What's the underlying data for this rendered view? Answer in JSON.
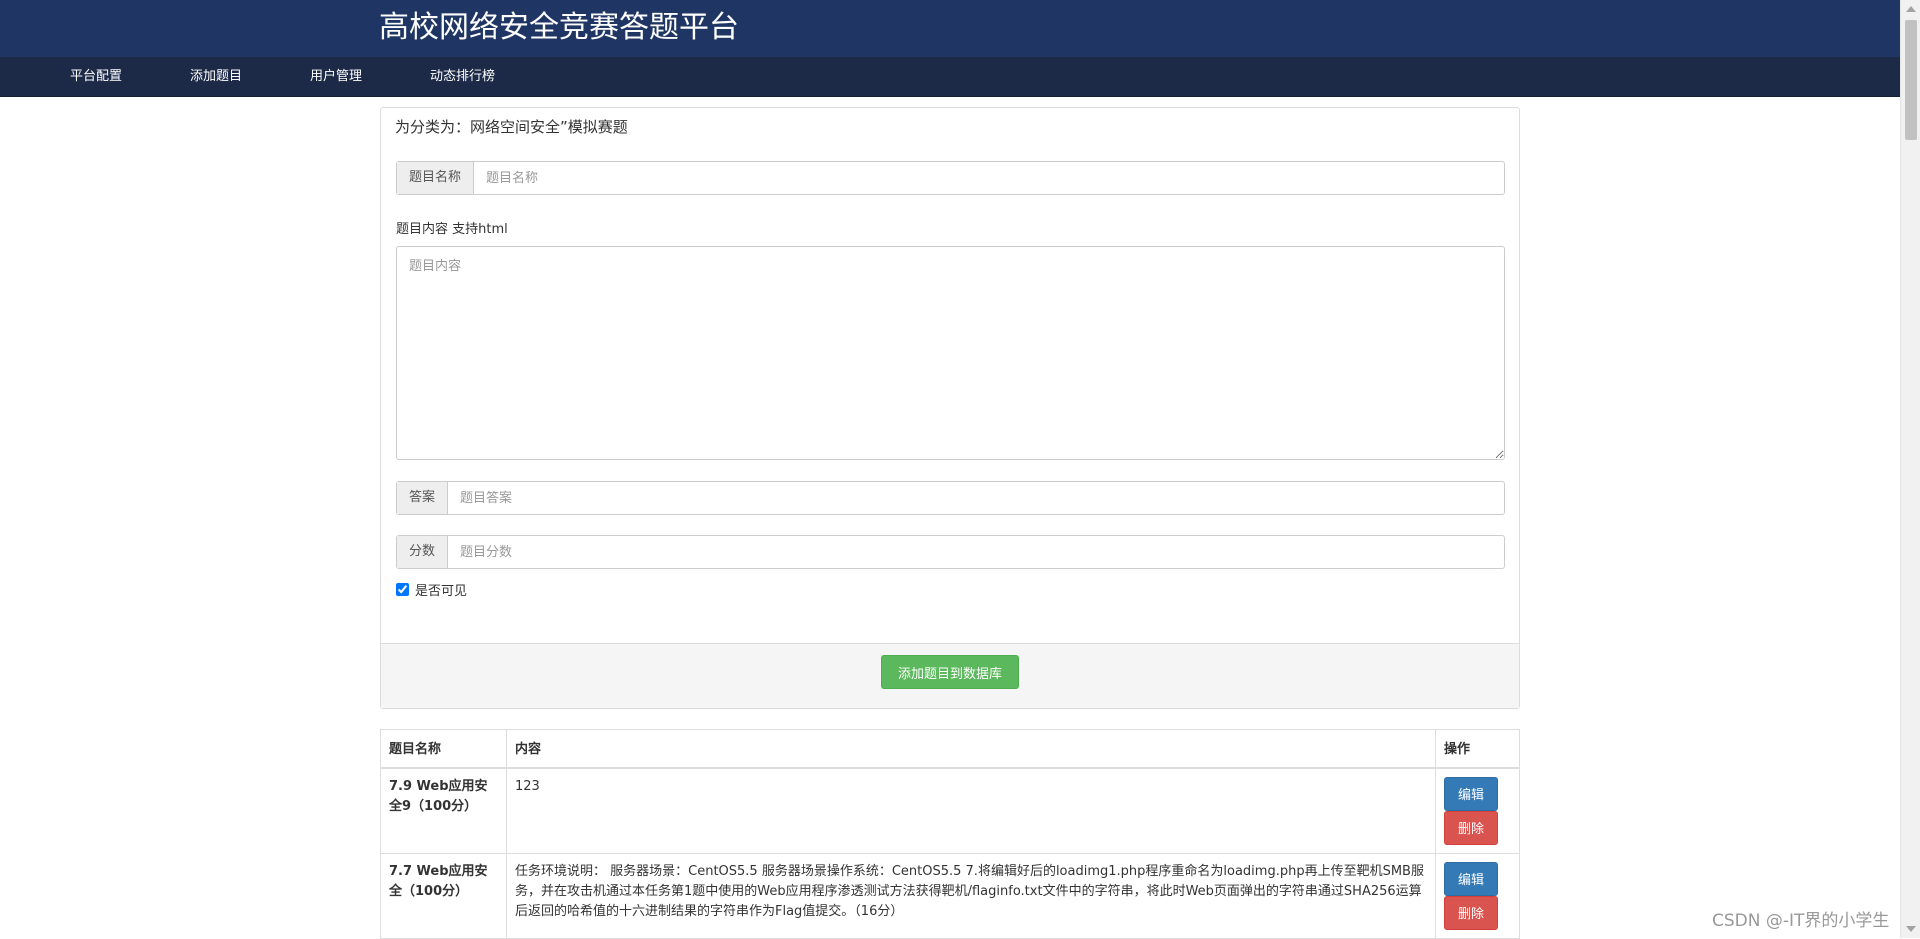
{
  "header": {
    "title": "高校网络安全竞赛答题平台"
  },
  "nav": {
    "items": [
      {
        "label": "平台配置"
      },
      {
        "label": "添加题目"
      },
      {
        "label": "用户管理"
      },
      {
        "label": "动态排行榜"
      }
    ]
  },
  "form": {
    "category_heading": "为分类为：网络空间安全”模拟赛题",
    "name_label": "题目名称",
    "name_placeholder": "题目名称",
    "content_label": "题目内容 支持html",
    "content_placeholder": "题目内容",
    "answer_label": "答案",
    "answer_placeholder": "题目答案",
    "score_label": "分数",
    "score_placeholder": "题目分数",
    "visible_label": "是否可见",
    "visible_checked": true,
    "submit_label": "添加题目到数据库"
  },
  "table": {
    "headers": [
      "题目名称",
      "内容",
      "操作"
    ],
    "edit_label": "编辑",
    "delete_label": "删除",
    "rows": [
      {
        "name": "7.9 Web应用安全9（100分）",
        "content": "123"
      },
      {
        "name": "7.7 Web应用安全（100分）",
        "content": "任务环境说明： 服务器场景：CentOS5.5 服务器场景操作系统：CentOS5.5 7.将编辑好后的loadimg1.php程序重命名为loadimg.php再上传至靶机SMB服务，并在攻击机通过本任务第1题中使用的Web应用程序渗透测试方法获得靶机/flaginfo.txt文件中的字符串，将此时Web页面弹出的字符串通过SHA256运算后返回的哈希值的十六进制结果的字符串作为Flag值提交。（16分）"
      }
    ]
  },
  "watermark": "CSDN @-IT界的小学生",
  "colors": {
    "header_bg": "#1f3664",
    "nav_bg": "#1c2a48",
    "success": "#5cb85c",
    "primary": "#337ab7",
    "danger": "#d9534f"
  }
}
